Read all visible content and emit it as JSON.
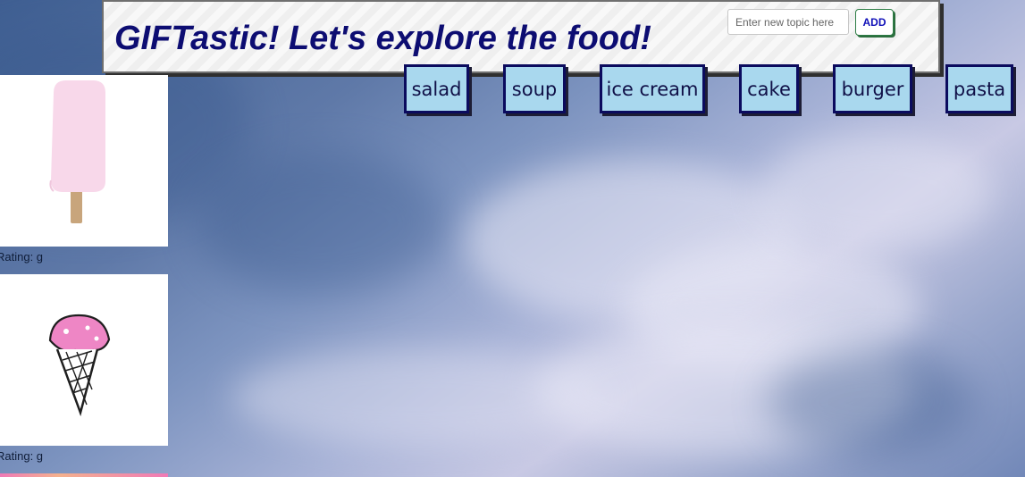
{
  "header": {
    "title": "GIFTastic! Let's explore the food!",
    "input_placeholder": "Enter new topic here",
    "add_label": "ADD"
  },
  "topics": [
    {
      "label": "salad"
    },
    {
      "label": "soup"
    },
    {
      "label": "ice cream"
    },
    {
      "label": "cake"
    },
    {
      "label": "burger"
    },
    {
      "label": "pasta"
    }
  ],
  "gifs": [
    {
      "rating_text": "Rating: g",
      "image": "popsicle-icon"
    },
    {
      "rating_text": "Rating: g",
      "image": "ice-cream-cone-icon"
    }
  ],
  "theme": {
    "title_color": "#0d0d72",
    "topic_bg": "#a9d8ee",
    "topic_border": "#0b0b5e",
    "add_text": "#1010b8"
  }
}
